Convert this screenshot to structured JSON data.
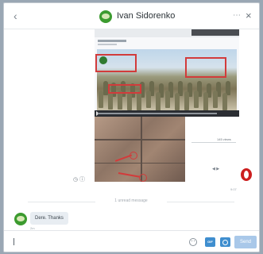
{
  "header": {
    "back_icon": "chevron-left-icon",
    "title": "Ivan Sidorenko",
    "more_icon": "ellipsis-icon",
    "close_icon": "close-icon"
  },
  "shared_content": {
    "views_text": "145 views",
    "time_label": "9:07"
  },
  "divider": {
    "label": "1 unread message"
  },
  "incoming": {
    "text": "Dere. Thanks",
    "time": "2m"
  },
  "composer": {
    "value": "",
    "gif_label": "GIF",
    "send_label": "Send"
  },
  "colors": {
    "accent": "#3f8ecf",
    "avatar": "#3c9b2f",
    "highlight_red": "#d23b3b"
  }
}
